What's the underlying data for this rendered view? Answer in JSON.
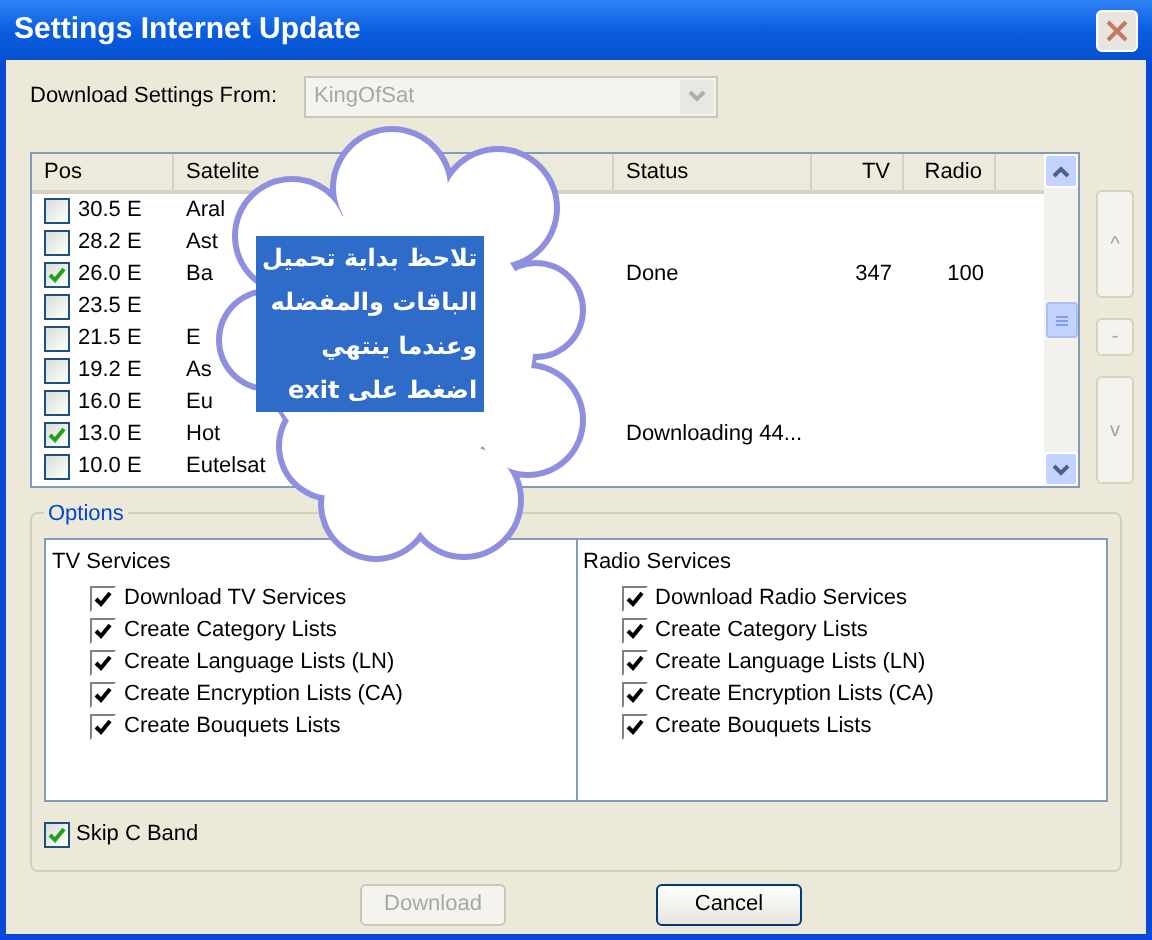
{
  "window": {
    "title": "Settings Internet Update"
  },
  "source": {
    "label": "Download Settings From:",
    "value": "KingOfSat",
    "disabled": true
  },
  "table": {
    "columns": [
      "Pos",
      "Satelite",
      "Status",
      "TV",
      "Radio"
    ],
    "rows": [
      {
        "checked": false,
        "pos": "30.5 E",
        "satellite": "Aral"
      },
      {
        "checked": false,
        "pos": "28.2 E",
        "satellite": "Ast"
      },
      {
        "checked": true,
        "pos": "26.0 E",
        "satellite": "Ba",
        "status": "Done",
        "tv": "347",
        "radio": "100"
      },
      {
        "checked": false,
        "pos": "23.5 E"
      },
      {
        "checked": false,
        "pos": "21.5 E",
        "satellite": "E"
      },
      {
        "checked": false,
        "pos": "19.2 E",
        "satellite": "As"
      },
      {
        "checked": false,
        "pos": "16.0 E",
        "satellite": "Eu"
      },
      {
        "checked": true,
        "pos": "13.0 E",
        "satellite": "Hot",
        "status": "Downloading 44..."
      },
      {
        "checked": false,
        "pos": "10.0 E",
        "satellite": "Eutelsat"
      }
    ]
  },
  "side_buttons": [
    "^",
    "-",
    "v"
  ],
  "callout": {
    "lines": [
      "تلاحظ بداية تحميل",
      "الباقات والمفضله",
      "وعندما ينتهي",
      "اضغط على exit"
    ]
  },
  "options": {
    "title": "Options",
    "groups": [
      {
        "title": "TV Services",
        "items": [
          {
            "label": "Download TV Services",
            "checked": true
          },
          {
            "label": "Create Category Lists",
            "checked": true
          },
          {
            "label": "Create Language Lists (LN)",
            "checked": true
          },
          {
            "label": "Create Encryption Lists (CA)",
            "checked": true
          },
          {
            "label": "Create Bouquets Lists",
            "checked": true
          }
        ]
      },
      {
        "title": "Radio Services",
        "items": [
          {
            "label": "Download Radio Services",
            "checked": true
          },
          {
            "label": "Create Category Lists",
            "checked": true
          },
          {
            "label": "Create Language Lists (LN)",
            "checked": true
          },
          {
            "label": "Create Encryption Lists (CA)",
            "checked": true
          },
          {
            "label": "Create Bouquets Lists",
            "checked": true
          }
        ]
      }
    ]
  },
  "skip": {
    "label": "Skip C Band",
    "checked": true
  },
  "buttons": [
    {
      "label": "Download",
      "disabled": true
    },
    {
      "label": "Cancel",
      "disabled": false
    }
  ]
}
